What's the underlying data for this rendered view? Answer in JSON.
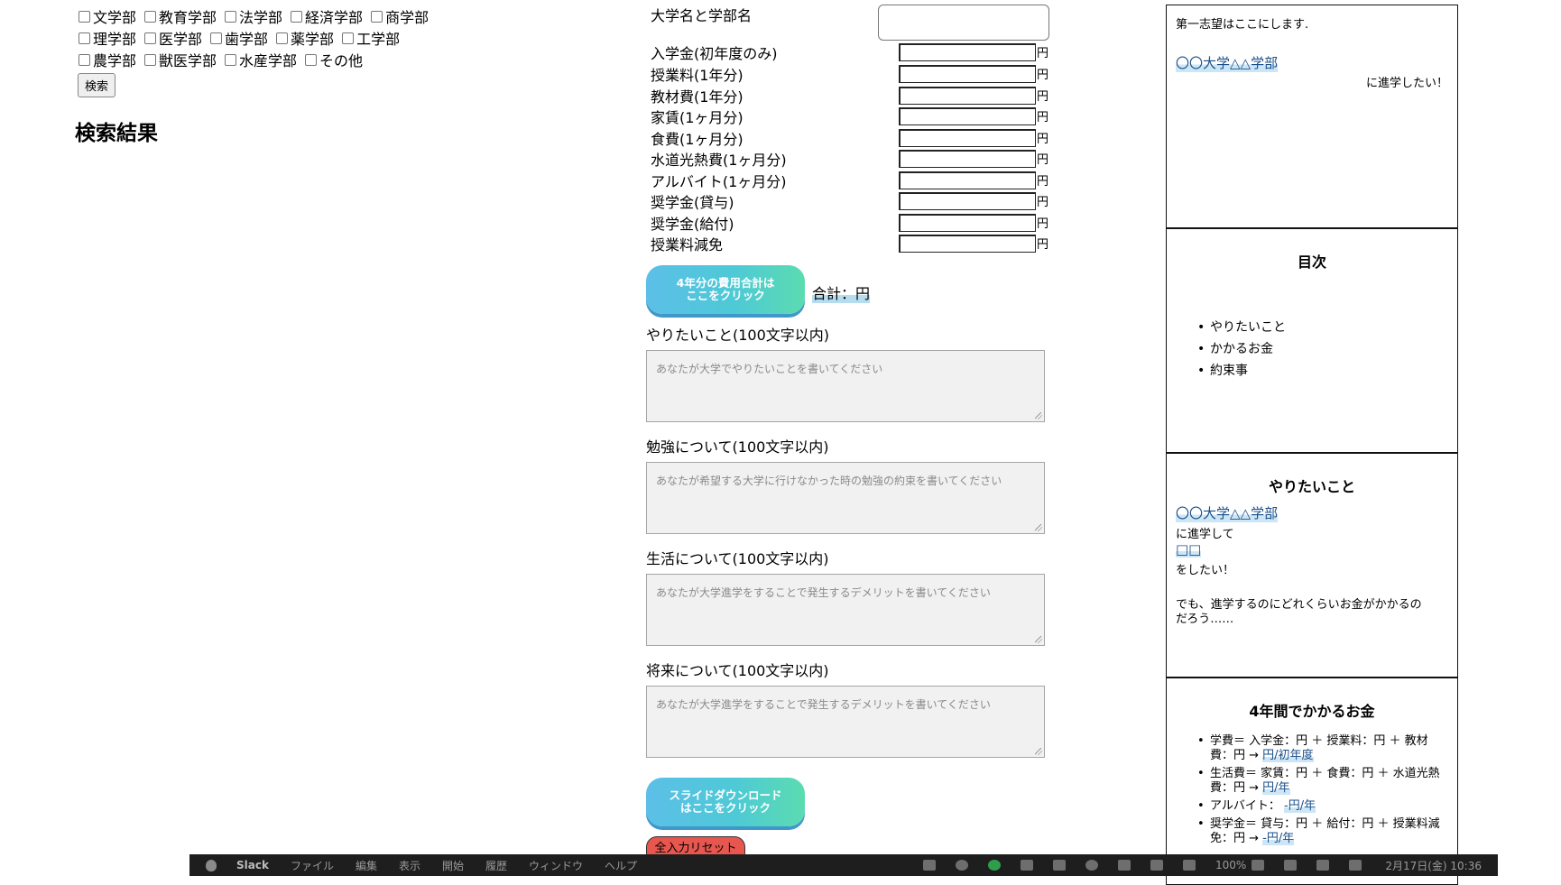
{
  "search": {
    "faculties": [
      [
        "文学部",
        "教育学部",
        "法学部",
        "経済学部",
        "商学部"
      ],
      [
        "理学部",
        "医学部",
        "歯学部",
        "薬学部",
        "工学部"
      ],
      [
        "農学部",
        "獣医学部",
        "水産学部",
        "その他"
      ]
    ],
    "button_label": "検索",
    "results_heading": "検索結果"
  },
  "form": {
    "university_label": "大学名と学部名",
    "yen": "円",
    "costs": [
      "入学金(初年度のみ)",
      "授業料(1年分)",
      "教材費(1年分)",
      "家賃(1ヶ月分)",
      "食費(1ヶ月分)",
      "水道光熱費(1ヶ月分)",
      "アルバイト(1ヶ月分)",
      "奨学金(貸与)",
      "奨学金(給付)",
      "授業料減免"
    ],
    "calc_button_line1": "4年分の費用合計は",
    "calc_button_line2": "ここをクリック",
    "total_text": "合計：円",
    "sections": [
      {
        "label": "やりたいこと(100文字以内)",
        "placeholder": "あなたが大学でやりたいことを書いてください"
      },
      {
        "label": "勉強について(100文字以内)",
        "placeholder": "あなたが希望する大学に行けなかった時の勉強の約束を書いてください"
      },
      {
        "label": "生活について(100文字以内)",
        "placeholder": "あなたが大学進学をすることで発生するデメリットを書いてください"
      },
      {
        "label": "将来について(100文字以内)",
        "placeholder": "あなたが大学進学をすることで発生するデメリットを書いてください"
      }
    ],
    "download_line1": "スライドダウンロード",
    "download_line2": "はここをクリック",
    "reset_label": "全入力リセット"
  },
  "slides": {
    "s1": {
      "intro": "第一志望はここにします.",
      "university": "〇〇大学△△学部",
      "suffix": "に進学したい！"
    },
    "s2": {
      "title": "目次",
      "items": [
        "やりたいこと",
        "かかるお金",
        "約束事"
      ]
    },
    "s3": {
      "title": "やりたいこと",
      "university": "〇〇大学△△学部",
      "line2": "に進学して",
      "placeholder": "□□",
      "line4": "をしたい！",
      "line5a": "でも、進学するのにどれくらいお金がかかるの",
      "line5b": "だろう……"
    },
    "s4": {
      "title": "4年間でかかるお金",
      "items": [
        {
          "text": "学費＝ 入学金：円 ＋ 授業料：円 ＋ 教材費：円 → ",
          "hl": "円/初年度"
        },
        {
          "text": "生活費＝ 家賃：円 ＋ 食費：円 ＋ 水道光熱費：円 → ",
          "hl": "円/年"
        },
        {
          "text": "アルバイト： ",
          "hl": "-円/年"
        },
        {
          "text": "奨学金＝ 貸与：円 ＋ 給付：円 ＋ 授業料減免：円 → ",
          "hl": "-円/年"
        }
      ]
    }
  },
  "menubar": {
    "app": "Slack",
    "menus": [
      "ファイル",
      "編集",
      "表示",
      "開始",
      "履歴",
      "ウィンドウ",
      "ヘルプ"
    ],
    "battery": "100%",
    "clock": "2月17日(金) 10:36"
  }
}
